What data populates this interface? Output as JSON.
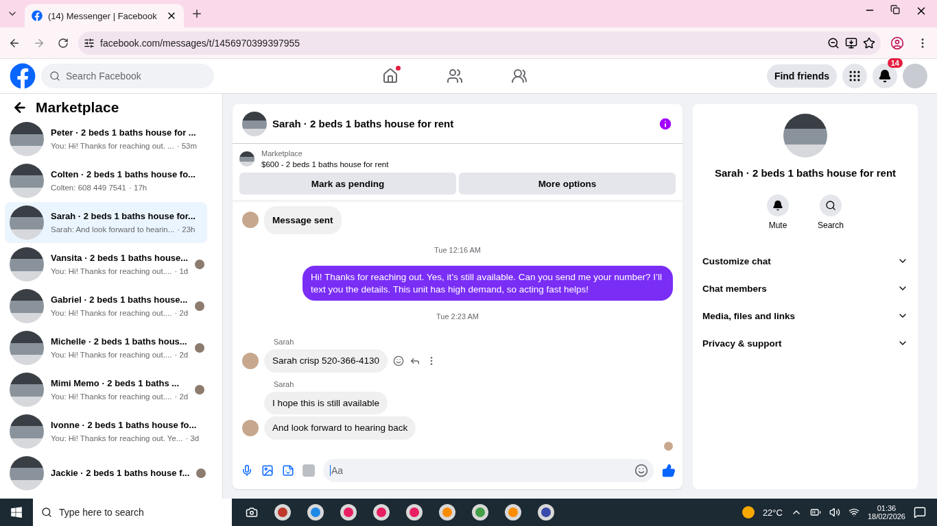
{
  "browser": {
    "tab_title": "(14) Messenger | Facebook",
    "url": "facebook.com/messages/t/1456970399397955"
  },
  "topbar": {
    "search_placeholder": "Search Facebook",
    "home_dot": true,
    "find_friends": "Find friends",
    "notification_count": "14"
  },
  "sidebar": {
    "title": "Marketplace",
    "conversations": [
      {
        "title": "Peter · 2 beds 1 baths house for ...",
        "preview": "You: Hi! Thanks for reaching out. ...",
        "time": "· 53m",
        "selected": false,
        "seen": false
      },
      {
        "title": "Colten · 2 beds 1 baths house fo...",
        "preview": "Colten: 608 449 7541",
        "time": "· 17h",
        "selected": false,
        "seen": false
      },
      {
        "title": "Sarah · 2 beds 1 baths house for...",
        "preview": "Sarah: And look forward to hearin...",
        "time": "· 23h",
        "selected": true,
        "seen": false
      },
      {
        "title": "Vansita · 2 beds 1 baths house...",
        "preview": "You: Hi! Thanks for reaching out....",
        "time": "· 1d",
        "selected": false,
        "seen": true
      },
      {
        "title": "Gabriel · 2 beds 1 baths house...",
        "preview": "You: Hi! Thanks for reaching out....",
        "time": "· 2d",
        "selected": false,
        "seen": true
      },
      {
        "title": "Michelle · 2 beds 1 baths hous...",
        "preview": "You: Hi! Thanks for reaching out....",
        "time": "· 2d",
        "selected": false,
        "seen": true
      },
      {
        "title": "Mimi Memo · 2 beds 1 baths ...",
        "preview": "You: Hi! Thanks for reaching out....",
        "time": "· 2d",
        "selected": false,
        "seen": true
      },
      {
        "title": "Ivonne · 2 beds 1 baths house fo...",
        "preview": "You: Hi! Thanks for reaching out. Ye...",
        "time": "· 3d",
        "selected": false,
        "seen": false
      },
      {
        "title": "Jackie · 2 beds 1 baths house f...",
        "selected": false,
        "seen": true
      }
    ]
  },
  "chat": {
    "title": "Sarah · 2 beds 1 baths house for rent",
    "listing": {
      "label": "Marketplace",
      "item": "$600 - 2 beds 1 baths house for rent"
    },
    "buttons": [
      "Mark as pending",
      "More options"
    ],
    "messages": [
      {
        "kind": "incoming",
        "text": "Message sent",
        "avatar": true,
        "emphasis": true
      },
      {
        "kind": "time",
        "text": "Tue 12:16 AM"
      },
      {
        "kind": "outgoing",
        "text": "Hi! Thanks for reaching out. Yes, it’s still available. Can you send me your number? I’ll text you the details. This unit has high demand, so acting fast helps!"
      },
      {
        "kind": "time",
        "text": "Tue 2:23 AM"
      },
      {
        "kind": "sender",
        "text": "Sarah"
      },
      {
        "kind": "incoming",
        "text": "Sarah crisp 520-366-4130",
        "avatar": true,
        "actions": true
      },
      {
        "kind": "sender",
        "text": "Sarah"
      },
      {
        "kind": "incoming",
        "text": "I hope this is still available",
        "avatar": false
      },
      {
        "kind": "incoming",
        "text": "And look forward to hearing back",
        "avatar": true
      },
      {
        "kind": "seen"
      }
    ],
    "composer_placeholder": "Aa"
  },
  "details": {
    "title": "Sarah · 2 beds 1 baths house for rent",
    "actions": [
      "Mute",
      "Search"
    ],
    "sections": [
      "Customize chat",
      "Chat members",
      "Media, files and links",
      "Privacy & support"
    ]
  },
  "taskbar": {
    "search_placeholder": "Type here to search",
    "weather": "22°C",
    "time": "01:36",
    "date": "18/02/2026"
  }
}
